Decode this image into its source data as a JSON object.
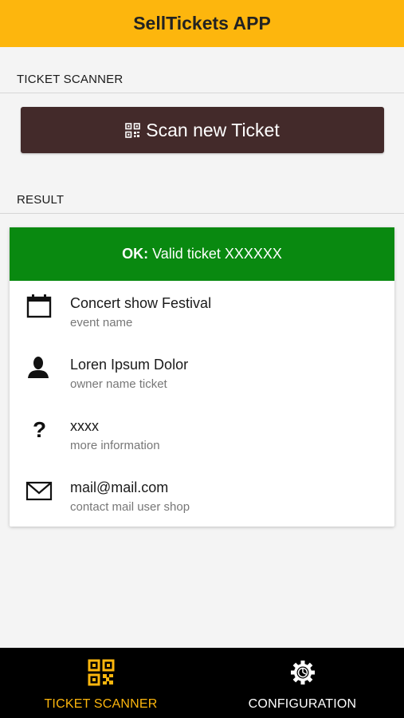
{
  "app": {
    "title": "SellTickets APP"
  },
  "scanner_section": {
    "title": "TICKET SCANNER",
    "scan_button_label": "Scan new Ticket",
    "scan_button_icon": "qr-code-icon"
  },
  "result_section": {
    "title": "RESULT",
    "status": {
      "prefix": "OK:",
      "message": "Valid ticket XXXXXX",
      "color": "#098910"
    },
    "items": [
      {
        "icon": "calendar-icon",
        "value": "Concert show Festival",
        "label": "event name"
      },
      {
        "icon": "person-icon",
        "value": "Loren Ipsum Dolor",
        "label": "owner name ticket"
      },
      {
        "icon": "question-icon",
        "value": "xxxx",
        "label": "more information"
      },
      {
        "icon": "mail-icon",
        "value": "mail@mail.com",
        "label": "contact mail user shop"
      }
    ]
  },
  "tab_bar": {
    "tabs": [
      {
        "label": "TICKET SCANNER",
        "icon": "qr-code-icon",
        "active": true
      },
      {
        "label": "CONFIGURATION",
        "icon": "gear-icon",
        "active": false
      }
    ],
    "active_color": "#fdb60d",
    "inactive_color": "#ffffff"
  },
  "colors": {
    "header": "#fdb60d",
    "scan_button": "#432a2a",
    "background": "#f4f4f4"
  }
}
